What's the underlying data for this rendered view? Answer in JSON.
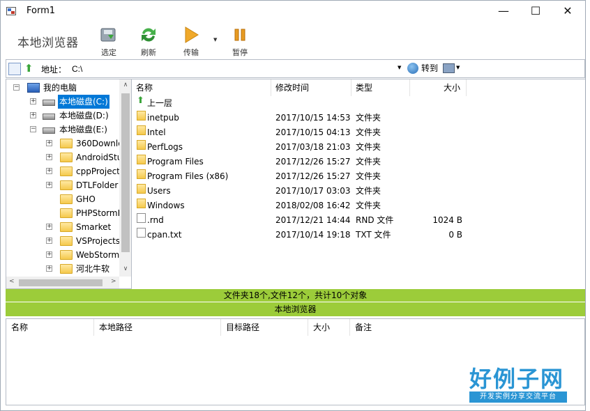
{
  "window": {
    "title": "Form1",
    "minimize_glyph": "—",
    "maximize_glyph": "☐",
    "close_glyph": "✕"
  },
  "toolbar": {
    "brand": "本地浏览器",
    "buttons": [
      {
        "label": "选定",
        "icon": "select-disk-icon"
      },
      {
        "label": "刷新",
        "icon": "refresh-icon"
      },
      {
        "label": "传输",
        "icon": "play-icon"
      },
      {
        "label": "暂停",
        "icon": "pause-icon"
      }
    ]
  },
  "address": {
    "label": "地址：",
    "value": "C:\\",
    "go_label": "转到"
  },
  "tree": {
    "items": [
      {
        "label": "我的电脑",
        "icon": "computer-icon",
        "expander": "−",
        "selected": false
      },
      {
        "label": "本地磁盘(C:)",
        "icon": "drive-icon",
        "expander": "+",
        "selected": true
      },
      {
        "label": "本地磁盘(D:)",
        "icon": "drive-icon",
        "expander": "+",
        "selected": false
      },
      {
        "label": "本地磁盘(E:)",
        "icon": "drive-icon",
        "expander": "−",
        "selected": false
      },
      {
        "label": "360Downlo",
        "icon": "folder-icon",
        "expander": "+"
      },
      {
        "label": "AndroidStu",
        "icon": "folder-icon",
        "expander": "+"
      },
      {
        "label": "cppProject",
        "icon": "folder-icon",
        "expander": "+"
      },
      {
        "label": "DTLFolder",
        "icon": "folder-icon",
        "expander": "+"
      },
      {
        "label": "GHO",
        "icon": "folder-icon",
        "expander": ""
      },
      {
        "label": "PHPStormP",
        "icon": "folder-icon",
        "expander": ""
      },
      {
        "label": "Smarket",
        "icon": "folder-icon",
        "expander": "+"
      },
      {
        "label": "VSProjects",
        "icon": "folder-icon",
        "expander": "+"
      },
      {
        "label": "WebStorm",
        "icon": "folder-icon",
        "expander": "+"
      },
      {
        "label": "河北牛软",
        "icon": "folder-icon",
        "expander": "+"
      }
    ]
  },
  "filelist": {
    "columns": [
      "名称",
      "修改时间",
      "类型",
      "大小"
    ],
    "up_label": "上一层",
    "rows": [
      {
        "name": "inetpub",
        "modified": "2017/10/15 14:53",
        "type": "文件夹",
        "size": "",
        "icon": "folder-icon"
      },
      {
        "name": "Intel",
        "modified": "2017/10/15 04:13",
        "type": "文件夹",
        "size": "",
        "icon": "folder-icon"
      },
      {
        "name": "PerfLogs",
        "modified": "2017/03/18 21:03",
        "type": "文件夹",
        "size": "",
        "icon": "folder-icon"
      },
      {
        "name": "Program Files",
        "modified": "2017/12/26 15:27",
        "type": "文件夹",
        "size": "",
        "icon": "folder-icon"
      },
      {
        "name": "Program Files (x86)",
        "modified": "2017/12/26 15:27",
        "type": "文件夹",
        "size": "",
        "icon": "folder-icon"
      },
      {
        "name": "Users",
        "modified": "2017/10/17 03:03",
        "type": "文件夹",
        "size": "",
        "icon": "folder-icon"
      },
      {
        "name": "Windows",
        "modified": "2018/02/08 16:42",
        "type": "文件夹",
        "size": "",
        "icon": "folder-icon"
      },
      {
        "name": ".rnd",
        "modified": "2017/12/21 14:44",
        "type": "RND 文件",
        "size": "1024 B",
        "icon": "file-icon"
      },
      {
        "name": "cpan.txt",
        "modified": "2017/10/14 19:18",
        "type": "TXT 文件",
        "size": "0 B",
        "icon": "file-icon"
      }
    ]
  },
  "status": {
    "summary": "文件夹18个,文件12个，共计10个对象",
    "panel_title": "本地浏览器"
  },
  "transfer": {
    "columns": [
      "名称",
      "本地路径",
      "目标路径",
      "大小",
      "备注"
    ]
  },
  "watermark": {
    "logo_text": "好例子网",
    "tagline": "开发实例分享交流平台"
  },
  "colors": {
    "status_bar": "#9ccc3a",
    "selection": "#0078d7",
    "logo": "#2a95d4"
  }
}
